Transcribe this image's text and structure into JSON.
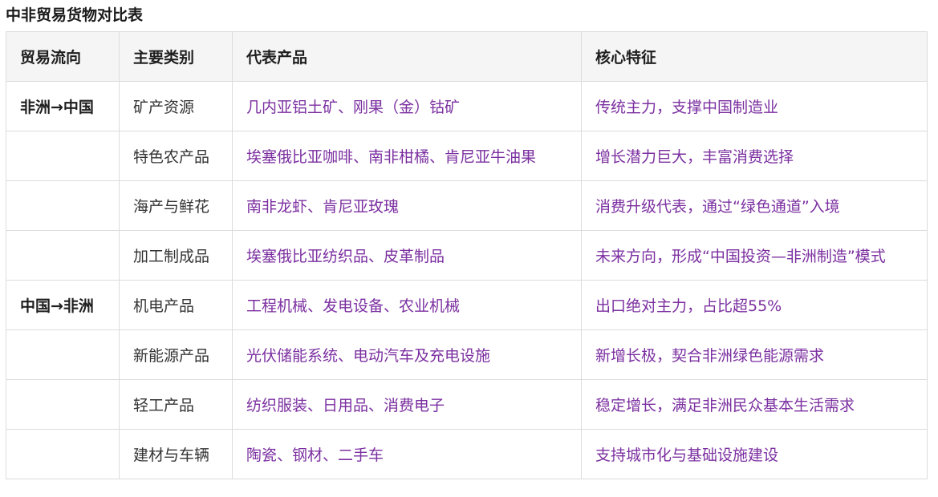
{
  "title": "中非贸易货物对比表",
  "table": {
    "headers": [
      "贸易流向",
      "主要类别",
      "代表产品",
      "核心特征"
    ],
    "rows": [
      {
        "flow": "非洲→中国",
        "category": "矿产资源",
        "product": "几内亚铝土矿、刚果（金）钴矿",
        "feature": "传统主力，支撑中国制造业"
      },
      {
        "flow": "",
        "category": "特色农产品",
        "product": "埃塞俄比亚咖啡、南非柑橘、肯尼亚牛油果",
        "feature": "增长潜力巨大，丰富消费选择"
      },
      {
        "flow": "",
        "category": "海产与鲜花",
        "product": "南非龙虾、肯尼亚玫瑰",
        "feature": "消费升级代表，通过“绿色通道”入境"
      },
      {
        "flow": "",
        "category": "加工制成品",
        "product": "埃塞俄比亚纺织品、皮革制品",
        "feature": "未来方向，形成“中国投资—非洲制造”模式"
      },
      {
        "flow": "中国→非洲",
        "category": "机电产品",
        "product": "工程机械、发电设备、农业机械",
        "feature": "出口绝对主力，占比超55%"
      },
      {
        "flow": "",
        "category": "新能源产品",
        "product": "光伏储能系统、电动汽车及充电设施",
        "feature": "新增长极，契合非洲绿色能源需求"
      },
      {
        "flow": "",
        "category": "轻工产品",
        "product": "纺织服装、日用品、消费电子",
        "feature": "稳定增长，满足非洲民众基本生活需求"
      },
      {
        "flow": "",
        "category": "建材与车辆",
        "product": "陶瓷、钢材、二手车",
        "feature": "支持城市化与基础设施建设"
      }
    ]
  },
  "colors": {
    "product_text": "#7b2fa0",
    "header_bg": "#f5f5f5",
    "border": "#dcdcdc"
  }
}
